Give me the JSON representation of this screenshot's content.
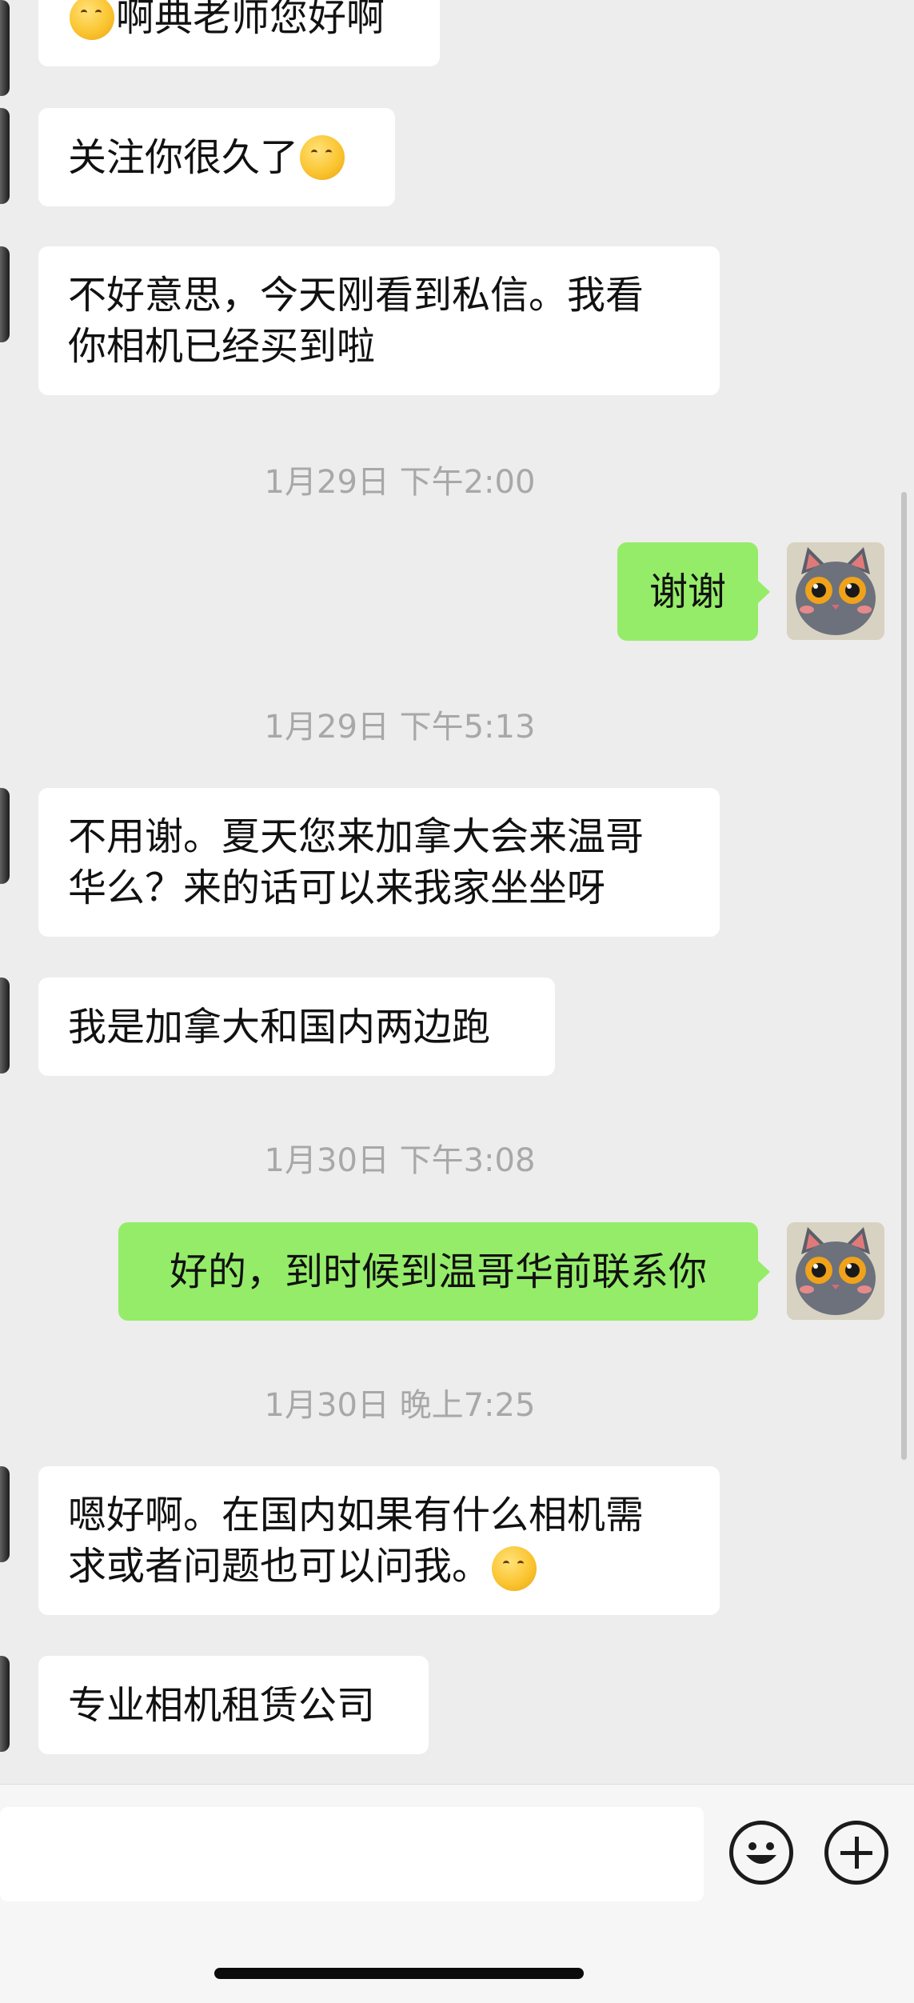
{
  "colors": {
    "background": "#ededed",
    "incoming_bubble": "#ffffff",
    "outgoing_bubble": "#95ec69",
    "timestamp": "#a8a8a8"
  },
  "messages": [
    {
      "side": "in",
      "text": "啊典老师您好啊",
      "emoji": "thinking-face"
    },
    {
      "side": "in",
      "text": "关注你很久了",
      "emoji": "thinking-face"
    },
    {
      "side": "in",
      "text": "不好意思，今天刚看到私信。我看\n你相机已经买到啦"
    },
    {
      "timestamp": "1月29日 下午2:00"
    },
    {
      "side": "out",
      "text": "谢谢"
    },
    {
      "timestamp": "1月29日 下午5:13"
    },
    {
      "side": "in",
      "text": "不用谢。夏天您来加拿大会来温哥\n华么？来的话可以来我家坐坐呀"
    },
    {
      "side": "in",
      "text": "我是加拿大和国内两边跑"
    },
    {
      "timestamp": "1月30日 下午3:08"
    },
    {
      "side": "out",
      "text": "好的，到时候到温哥华前联系你"
    },
    {
      "timestamp": "1月30日 晚上7:25"
    },
    {
      "side": "in",
      "text": "嗯好啊。在国内如果有什么相机需\n求或者问题也可以问我。",
      "emoji": "thinking-face"
    },
    {
      "side": "in",
      "text": "专业相机租赁公司"
    }
  ],
  "input_bar": {
    "value": "",
    "icons": [
      "smiley-icon",
      "plus-icon"
    ]
  }
}
